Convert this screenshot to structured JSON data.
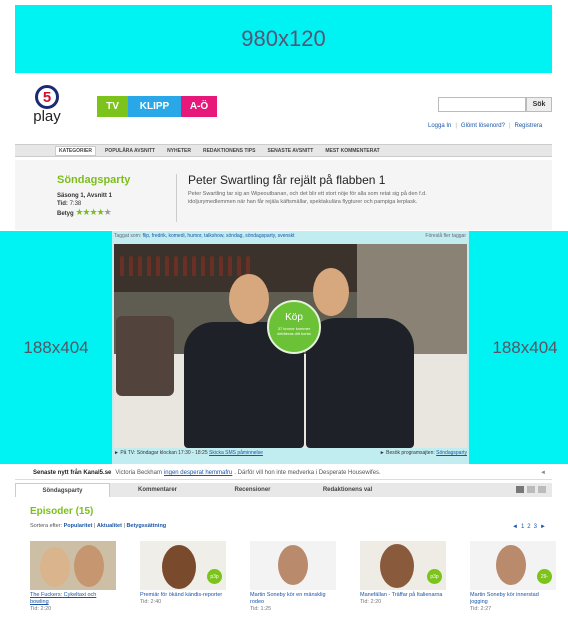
{
  "ads": {
    "top": "980x120",
    "left": "188x404",
    "right": "188x404"
  },
  "logo": {
    "number": "5",
    "text": "play"
  },
  "nav_tabs": [
    {
      "label": "TV",
      "color": "#7cc31c"
    },
    {
      "label": "KLIPP",
      "color": "#2aa7e6"
    },
    {
      "label": "A-Ö",
      "color": "#e8187b"
    }
  ],
  "search": {
    "button": "Sök",
    "placeholder": ""
  },
  "user_links": {
    "login": "Logga In",
    "forgot": "Glömt lösenord?",
    "register": "Registrera"
  },
  "categories": [
    "KATEGORIER",
    "POPULÄRA AVSNITT",
    "NYHETER",
    "REDAKTIONENS TIPS",
    "SENASTE AVSNITT",
    "MEST KOMMENTERAT"
  ],
  "show": {
    "title": "Söndagsparty",
    "season_episode": "Säsong 1, Avsnitt 1",
    "time_label": "Tid:",
    "time": "7:38",
    "rating_label": "Betyg",
    "rating": 4,
    "rating_max": 5
  },
  "episode": {
    "title": "Peter Swartling får rejält på flabben 1",
    "description": "Peter Swartling tar sig an Wipeoutbanan, och det blir ett stort nöje för alla som retat sig på den f.d. idoljurymedlemmen när han får rejäla käftsmällar, spektakulära flygturer och pampiga lerplask."
  },
  "player": {
    "tags_label": "Taggat som:",
    "tags": "flip, fredrik, komedi, humor, talkshow, söndag, söndagsparty, svenskt",
    "report": "Föreslå fler taggar",
    "buy_label": "Köp",
    "buy_sub": "37 kronor kommer debiteras ditt konto",
    "tv_info": "► På TV: Söndagar klockan 17:30 - 18:25",
    "sms": "Skicka SMS påminnelse",
    "visit_label": "► Besök programsajten:",
    "visit_link": "Söndagsparty"
  },
  "news": {
    "label": "Senaste nytt från Kanal5.se",
    "prefix": "Victoria Beckham",
    "link": "ingen desperat hemmafru",
    "suffix": ". Därför vill hon inte medverka i Desperate Housewifes."
  },
  "section_tabs": [
    "Söndagsparty",
    "Kommentarer",
    "Recensioner",
    "Redaktionens val"
  ],
  "episodes": {
    "heading": "Episoder (15)",
    "sort_label": "Sortera efter:",
    "sort_options": [
      "Popularitet",
      "Aktualitet",
      "Betygssättning"
    ],
    "pager": [
      "◄",
      "1",
      "2",
      "3",
      "►"
    ],
    "items": [
      {
        "title": "The Fuckers: Cykeltaxi och bowling",
        "time": "Tid: 2:20",
        "badge": ""
      },
      {
        "title": "Premiär för ökänd kändis-reporter",
        "time": "Tid: 2:40",
        "badge": "p3p"
      },
      {
        "title": "Martin Soneby kör en mänsklig rodeo",
        "time": "Tid: 1:25",
        "badge": ""
      },
      {
        "title": "Manefällan - Träffar på Italienarna",
        "time": "Tid: 2:20",
        "badge": "p3p"
      },
      {
        "title": "Martin Soneby kör innerstad jogging",
        "time": "Tid: 2:27",
        "badge": "29-"
      }
    ]
  }
}
